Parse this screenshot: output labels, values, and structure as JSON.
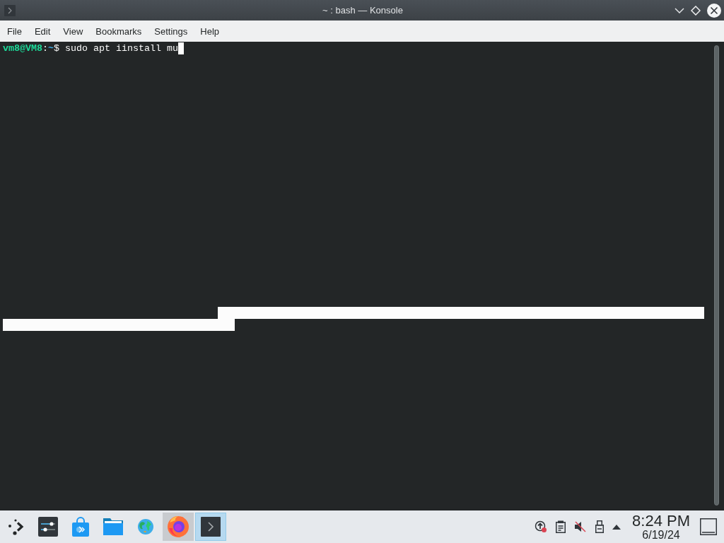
{
  "window": {
    "title": "~ : bash — Konsole"
  },
  "menu": [
    "File",
    "Edit",
    "View",
    "Bookmarks",
    "Settings",
    "Help"
  ],
  "terminal": {
    "lines": [
      {
        "user_host": "vm8@VM8",
        "separator": ":",
        "path": "~",
        "prompt_symbol": "$",
        "command": "sudo apt iinstall mu",
        "cursor": true
      }
    ],
    "selection": true
  },
  "taskbar": {
    "tasks": [
      {
        "kind": "settings",
        "running": false,
        "selected": false
      },
      {
        "kind": "store",
        "running": false,
        "selected": false
      },
      {
        "kind": "folder",
        "running": false,
        "selected": false
      },
      {
        "kind": "globe",
        "running": false,
        "selected": false
      },
      {
        "kind": "browser",
        "running": true,
        "selected": false
      },
      {
        "kind": "terminal",
        "running": true,
        "selected": true
      }
    ],
    "tray": {
      "update_alert": true,
      "volume_muted": true
    },
    "clock": {
      "time": "8:24 PM",
      "date": "6/19/24"
    }
  }
}
